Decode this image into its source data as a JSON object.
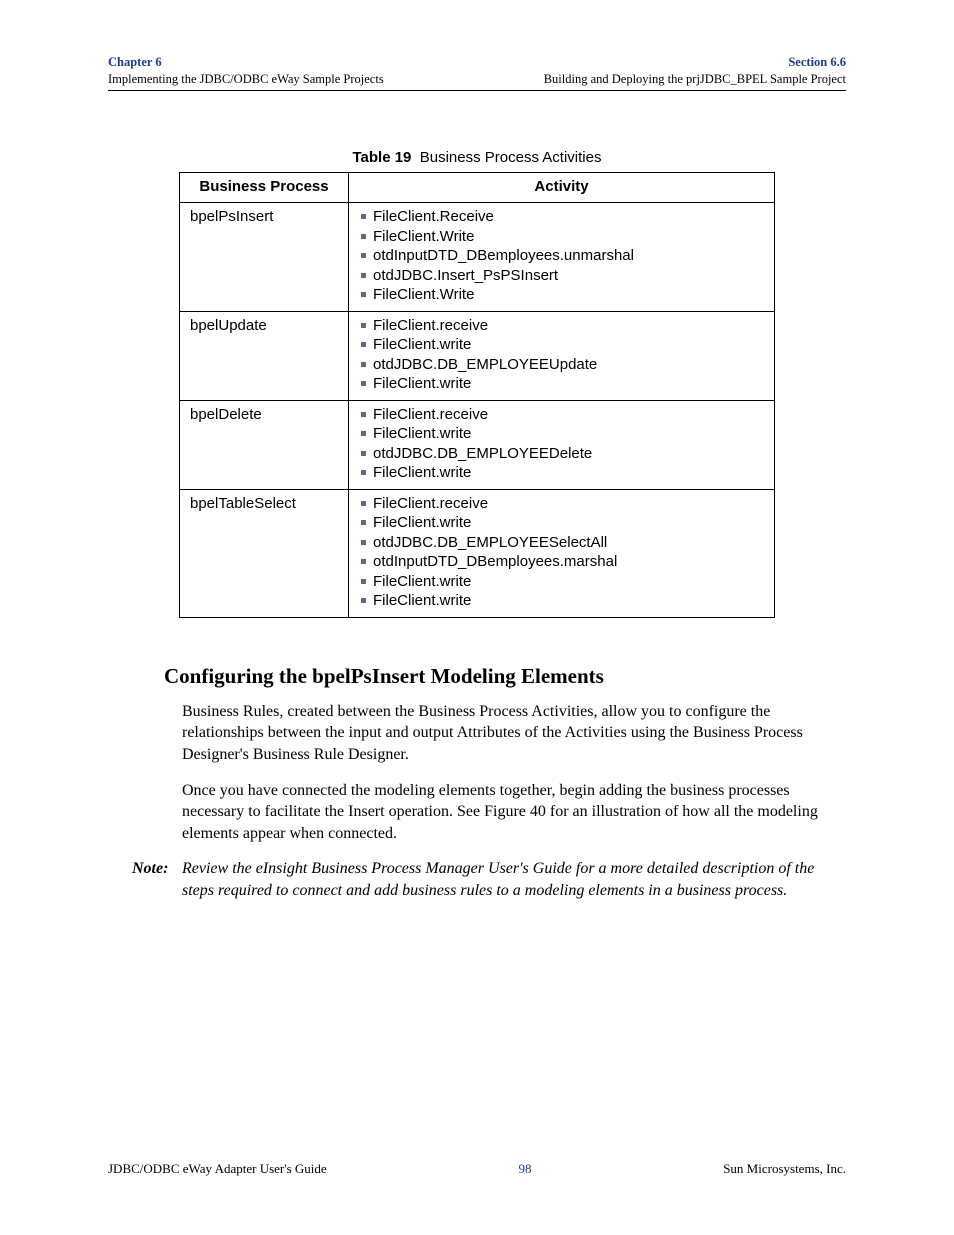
{
  "header": {
    "chapter": "Chapter 6",
    "section": "Section 6.6",
    "left_sub": "Implementing the JDBC/ODBC eWay Sample Projects",
    "right_sub": "Building and Deploying the prjJDBC_BPEL Sample Project"
  },
  "table": {
    "caption_num": "Table 19",
    "caption_text": "Business Process Activities",
    "col1": "Business Process",
    "col2": "Activity",
    "rows": [
      {
        "process": "bpelPsInsert",
        "activities": [
          "FileClient.Receive",
          "FileClient.Write",
          "otdInputDTD_DBemployees.unmarshal",
          "otdJDBC.Insert_PsPSInsert",
          "FileClient.Write"
        ]
      },
      {
        "process": "bpelUpdate",
        "activities": [
          "FileClient.receive",
          "FileClient.write",
          "otdJDBC.DB_EMPLOYEEUpdate",
          "FileClient.write"
        ]
      },
      {
        "process": "bpelDelete",
        "activities": [
          "FileClient.receive",
          "FileClient.write",
          "otdJDBC.DB_EMPLOYEEDelete",
          "FileClient.write"
        ]
      },
      {
        "process": "bpelTableSelect",
        "activities": [
          "FileClient.receive",
          "FileClient.write",
          "otdJDBC.DB_EMPLOYEESelectAll",
          "otdInputDTD_DBemployees.marshal",
          "FileClient.write",
          "FileClient.write"
        ]
      }
    ]
  },
  "section_heading": "Configuring the bpelPsInsert Modeling Elements",
  "paragraphs": [
    "Business Rules, created between the Business Process Activities, allow you to configure the relationships between the input and output Attributes of the Activities using the Business Process Designer's Business Rule Designer.",
    "Once you have connected the modeling elements together, begin adding the business processes necessary to facilitate the Insert operation. See Figure 40 for an illustration of how all the modeling elements appear when connected."
  ],
  "note": {
    "label": "Note:",
    "text": "Review the eInsight Business Process Manager User's Guide for a more detailed description of the steps required to connect and add business rules to a modeling elements in a business process."
  },
  "footer": {
    "left": "JDBC/ODBC eWay Adapter User's Guide",
    "page": "98",
    "right": "Sun Microsystems, Inc."
  },
  "chart_data": {
    "type": "table",
    "title": "Table 19 Business Process Activities",
    "columns": [
      "Business Process",
      "Activity"
    ],
    "rows": [
      [
        "bpelPsInsert",
        [
          "FileClient.Receive",
          "FileClient.Write",
          "otdInputDTD_DBemployees.unmarshal",
          "otdJDBC.Insert_PsPSInsert",
          "FileClient.Write"
        ]
      ],
      [
        "bpelUpdate",
        [
          "FileClient.receive",
          "FileClient.write",
          "otdJDBC.DB_EMPLOYEEUpdate",
          "FileClient.write"
        ]
      ],
      [
        "bpelDelete",
        [
          "FileClient.receive",
          "FileClient.write",
          "otdJDBC.DB_EMPLOYEEDelete",
          "FileClient.write"
        ]
      ],
      [
        "bpelTableSelect",
        [
          "FileClient.receive",
          "FileClient.write",
          "otdJDBC.DB_EMPLOYEESelectAll",
          "otdInputDTD_DBemployees.marshal",
          "FileClient.write",
          "FileClient.write"
        ]
      ]
    ]
  }
}
